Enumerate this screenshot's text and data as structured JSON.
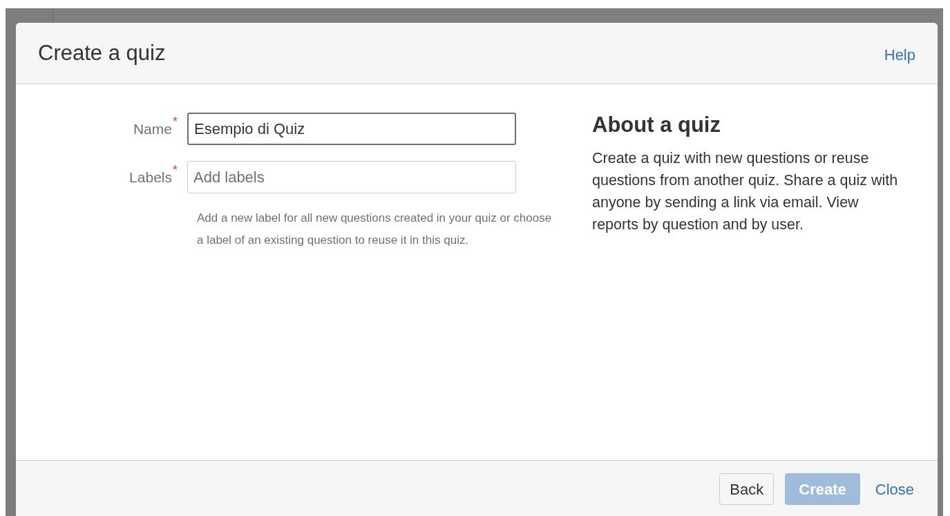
{
  "dialog": {
    "title": "Create a quiz",
    "help_link": "Help",
    "fields": [
      {
        "label": "Name",
        "required_mark": "*",
        "value": "Esempio di Quiz",
        "focused": true
      },
      {
        "label": "Labels",
        "required_mark": "*",
        "placeholder": "Add labels",
        "focused": false
      }
    ],
    "hint": "Add a new label for all new questions created in your quiz or choose a label of an existing question to reuse it in this quiz.",
    "about": {
      "heading": "About a quiz",
      "text": "Create a quiz with new questions or reuse questions from another quiz. Share a quiz with anyone by sending a link via email. View reports by question and by user."
    },
    "buttons": [
      {
        "label": "Back",
        "kind": "secondary",
        "disabled": false
      },
      {
        "label": "Create",
        "kind": "primary",
        "disabled": true
      },
      {
        "label": "Close",
        "kind": "link",
        "disabled": false
      }
    ]
  }
}
